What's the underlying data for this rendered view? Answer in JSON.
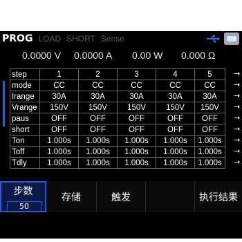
{
  "header": {
    "mode": "PROG",
    "tabs": [
      "LOAD",
      "SHORT",
      "Sense"
    ]
  },
  "readings": {
    "voltage": "0.0000 V",
    "current": "0.0000 A",
    "power": "0.00 W",
    "resistance": "0.000 Ω"
  },
  "table": {
    "header": [
      "step",
      "1",
      "2",
      "3",
      "4",
      "5"
    ],
    "rows": [
      [
        "mode",
        "CC",
        "CC",
        "CC",
        "CC",
        "CC"
      ],
      [
        "Irange",
        "30A",
        "30A",
        "30A",
        "30A",
        "30A"
      ],
      [
        "Vrange",
        "150V",
        "150V",
        "150V",
        "150V",
        "150V"
      ],
      [
        "paus",
        "OFF",
        "OFF",
        "OFF",
        "OFF",
        "OFF"
      ],
      [
        "short",
        "OFF",
        "OFF",
        "OFF",
        "OFF",
        "OFF"
      ],
      [
        "Ton",
        "1.000s",
        "1.000s",
        "1.000s",
        "1.000s",
        "1.000s"
      ],
      [
        "Toff",
        "1.000s",
        "1.000s",
        "1.000s",
        "1.000s",
        "1.000s"
      ],
      [
        "Tdly",
        "1.000s",
        "1.000s",
        "1.000s",
        "1.000s",
        "1.000s"
      ]
    ]
  },
  "softkeys": {
    "step_label": "步数",
    "step_value": "50",
    "store": "存储",
    "trigger": "触发",
    "result": "执行结果"
  },
  "colors": {
    "accent": "#2f57d6",
    "background": "#000000",
    "text": "#ffffff"
  }
}
